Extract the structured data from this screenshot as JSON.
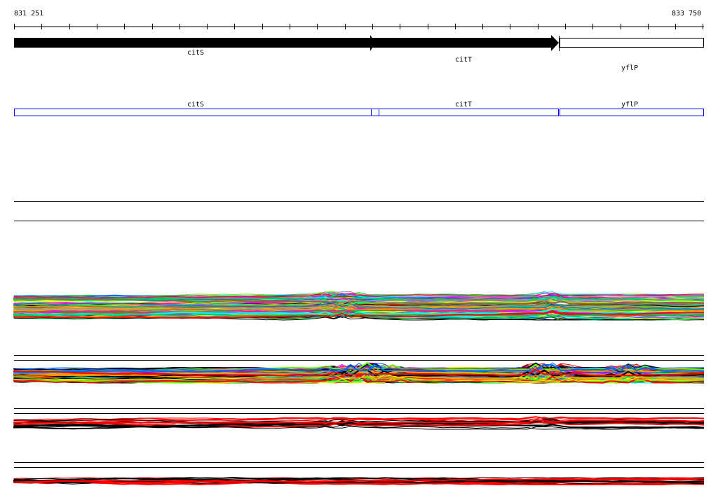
{
  "ruler": {
    "start_label": "831 251",
    "end_label": "833 750"
  },
  "genes": [
    {
      "name": "citS",
      "strand": "forward",
      "filled": true
    },
    {
      "name": "citT",
      "strand": "forward",
      "filled": true
    },
    {
      "name": "yflP",
      "strand": "none",
      "filled": false
    }
  ],
  "annotation_track": {
    "labels": [
      "citS",
      "citT",
      "yflP"
    ],
    "color": "#0000ff"
  },
  "colors": {
    "profile_palette": [
      "#ff0000",
      "#0066ff",
      "#00ffff",
      "#ff00ff",
      "#66ff00",
      "#ff9900",
      "#999999",
      "#000000",
      "#cc00cc",
      "#ffff00",
      "#996633",
      "#00cc66"
    ],
    "axis": "#000000"
  }
}
